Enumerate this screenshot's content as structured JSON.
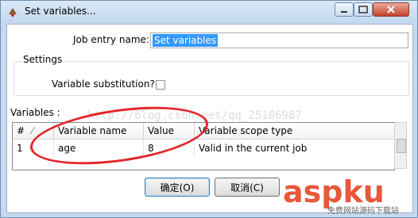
{
  "window": {
    "title": "Set variables..."
  },
  "job_entry": {
    "label": "Job entry name:",
    "value": "Set variables"
  },
  "settings": {
    "title": "Settings",
    "variable_substitution_label": "Variable substitution?",
    "variable_substitution_checked": false
  },
  "variables": {
    "label": "Variables :",
    "columns": [
      "#",
      "Variable name",
      "Value",
      "Variable scope type"
    ],
    "rows": [
      {
        "num": "1",
        "name": "age",
        "value": "8",
        "scope": "Valid in the current job"
      }
    ]
  },
  "buttons": {
    "ok": "确定(O)",
    "cancel": "取消(C)"
  },
  "watermark": "http://blog.csdn.net/qq_25186987",
  "logo": {
    "brand": "aspku",
    "tagline": "免费网站源码下载站"
  },
  "colors": {
    "accent": "#3399ff",
    "annotation": "#e3262b",
    "logo": "#e8573a"
  }
}
